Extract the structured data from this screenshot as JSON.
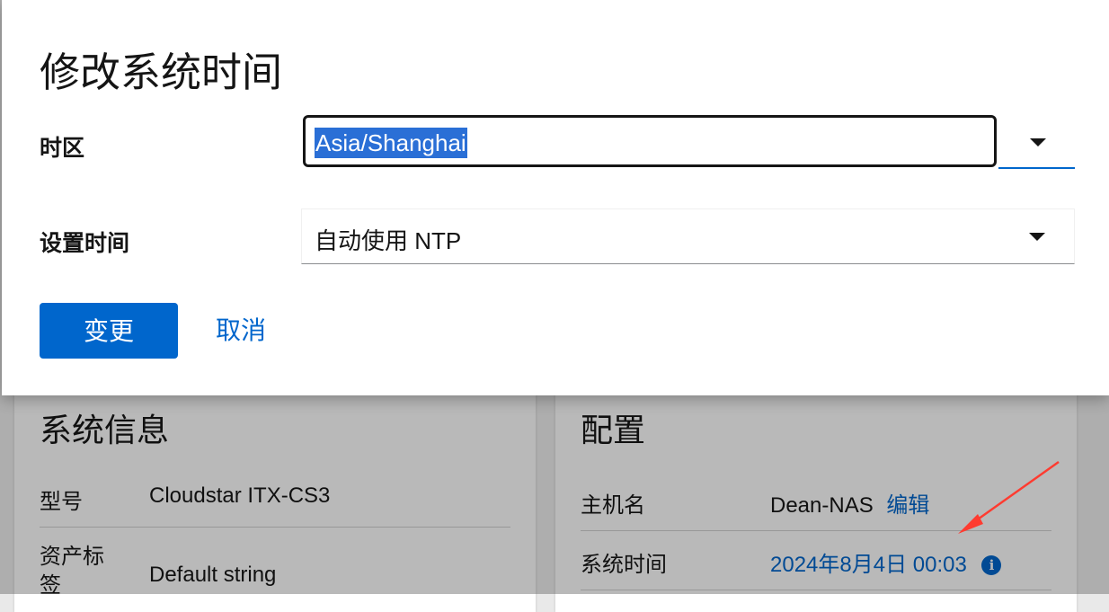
{
  "background": {
    "system_info": {
      "title": "系统信息",
      "rows": [
        {
          "key": "型号",
          "value": "Cloudstar ITX-CS3"
        },
        {
          "key": "资产标签",
          "value": "Default string"
        }
      ]
    },
    "config": {
      "title": "配置",
      "hostname_label": "主机名",
      "hostname_value": "Dean-NAS",
      "hostname_edit": "编辑",
      "system_time_label": "系统时间",
      "system_time_value": "2024年8月4日 00:03",
      "info_icon": "i"
    }
  },
  "modal": {
    "title": "修改系统时间",
    "timezone_label": "时区",
    "timezone_value": "Asia/Shanghai",
    "set_time_label": "设置时间",
    "set_time_value": "自动使用 NTP",
    "confirm_button": "变更",
    "cancel_button": "取消"
  },
  "colors": {
    "accent": "#0066cc",
    "selection": "#2a6fd6",
    "annotation_arrow": "#ff3b30"
  },
  "icons": [
    "chevron-down-icon",
    "info-circle-icon",
    "annotation-arrow"
  ]
}
